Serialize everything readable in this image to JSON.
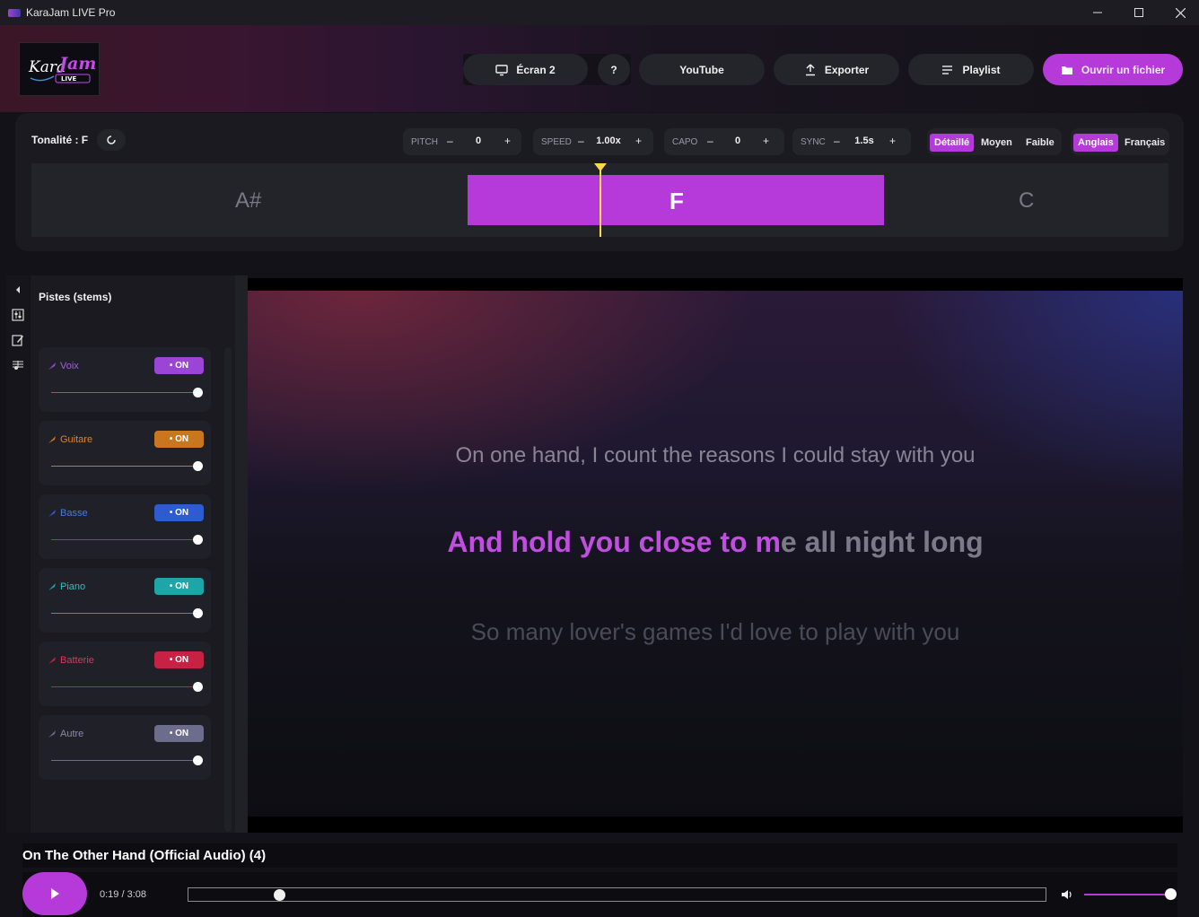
{
  "window": {
    "title": "KaraJam LIVE Pro"
  },
  "logo": {
    "text": "KaraJam",
    "sub": "LIVE"
  },
  "header": {
    "screen_label": "Écran 2",
    "help_label": "?",
    "youtube_label": "YouTube",
    "export_label": "Exporter",
    "playlist_label": "Playlist",
    "open_label": "Ouvrir un fichier"
  },
  "tuner": {
    "tonality_label": "Tonalité : F",
    "pitch": {
      "label": "PITCH",
      "minus": "–",
      "value": "0",
      "plus": "+"
    },
    "speed": {
      "label": "SPEED",
      "minus": "–",
      "value": "1.00x",
      "plus": "+"
    },
    "capo": {
      "label": "CAPO",
      "minus": "–",
      "value": "0",
      "plus": "+"
    },
    "sync": {
      "label": "SYNC",
      "minus": "–",
      "value": "1.5s",
      "plus": "+"
    },
    "detail_modes": [
      "Détaillé",
      "Moyen",
      "Faible"
    ],
    "detail_selected": "Détaillé",
    "languages": [
      "Anglais",
      "Français"
    ],
    "language_selected": "Anglais",
    "keys": {
      "prev": "A#",
      "current": "F",
      "next": "C"
    }
  },
  "stems": {
    "title": "Pistes (stems)",
    "items": [
      {
        "name": "Voix",
        "toggle": "• ON",
        "color": "#9b45d6",
        "text_color": "#a55ee0",
        "level": 1.0
      },
      {
        "name": "Guitare",
        "toggle": "• ON",
        "color": "#c9771e",
        "text_color": "#d4872c",
        "level": 1.0
      },
      {
        "name": "Basse",
        "toggle": "• ON",
        "color": "#2e5bd0",
        "text_color": "#4a7ae0",
        "level": 1.0
      },
      {
        "name": "Piano",
        "toggle": "• ON",
        "color": "#1ea5a8",
        "text_color": "#2cc0c4",
        "level": 1.0
      },
      {
        "name": "Batterie",
        "toggle": "• ON",
        "color": "#c72244",
        "text_color": "#d63a5a",
        "level": 1.0
      },
      {
        "name": "Autre",
        "toggle": "• ON",
        "color": "#6c6c8c",
        "text_color": "#8a8aa6",
        "level": 1.0
      }
    ]
  },
  "lyrics": {
    "previous": "On one hand, I count the reasons I could stay with you",
    "current_sung": "And hold you close to m",
    "current_unsung": "e all night long",
    "next": "So many lover's games I'd love to play with you"
  },
  "player": {
    "song_title": "On The Other Hand (Official Audio) (4)",
    "time": "0:19 / 3:08",
    "progress": 0.101,
    "volume": 1.0
  },
  "colors": {
    "accent": "#b63ad9",
    "marker": "#ffd84a"
  }
}
